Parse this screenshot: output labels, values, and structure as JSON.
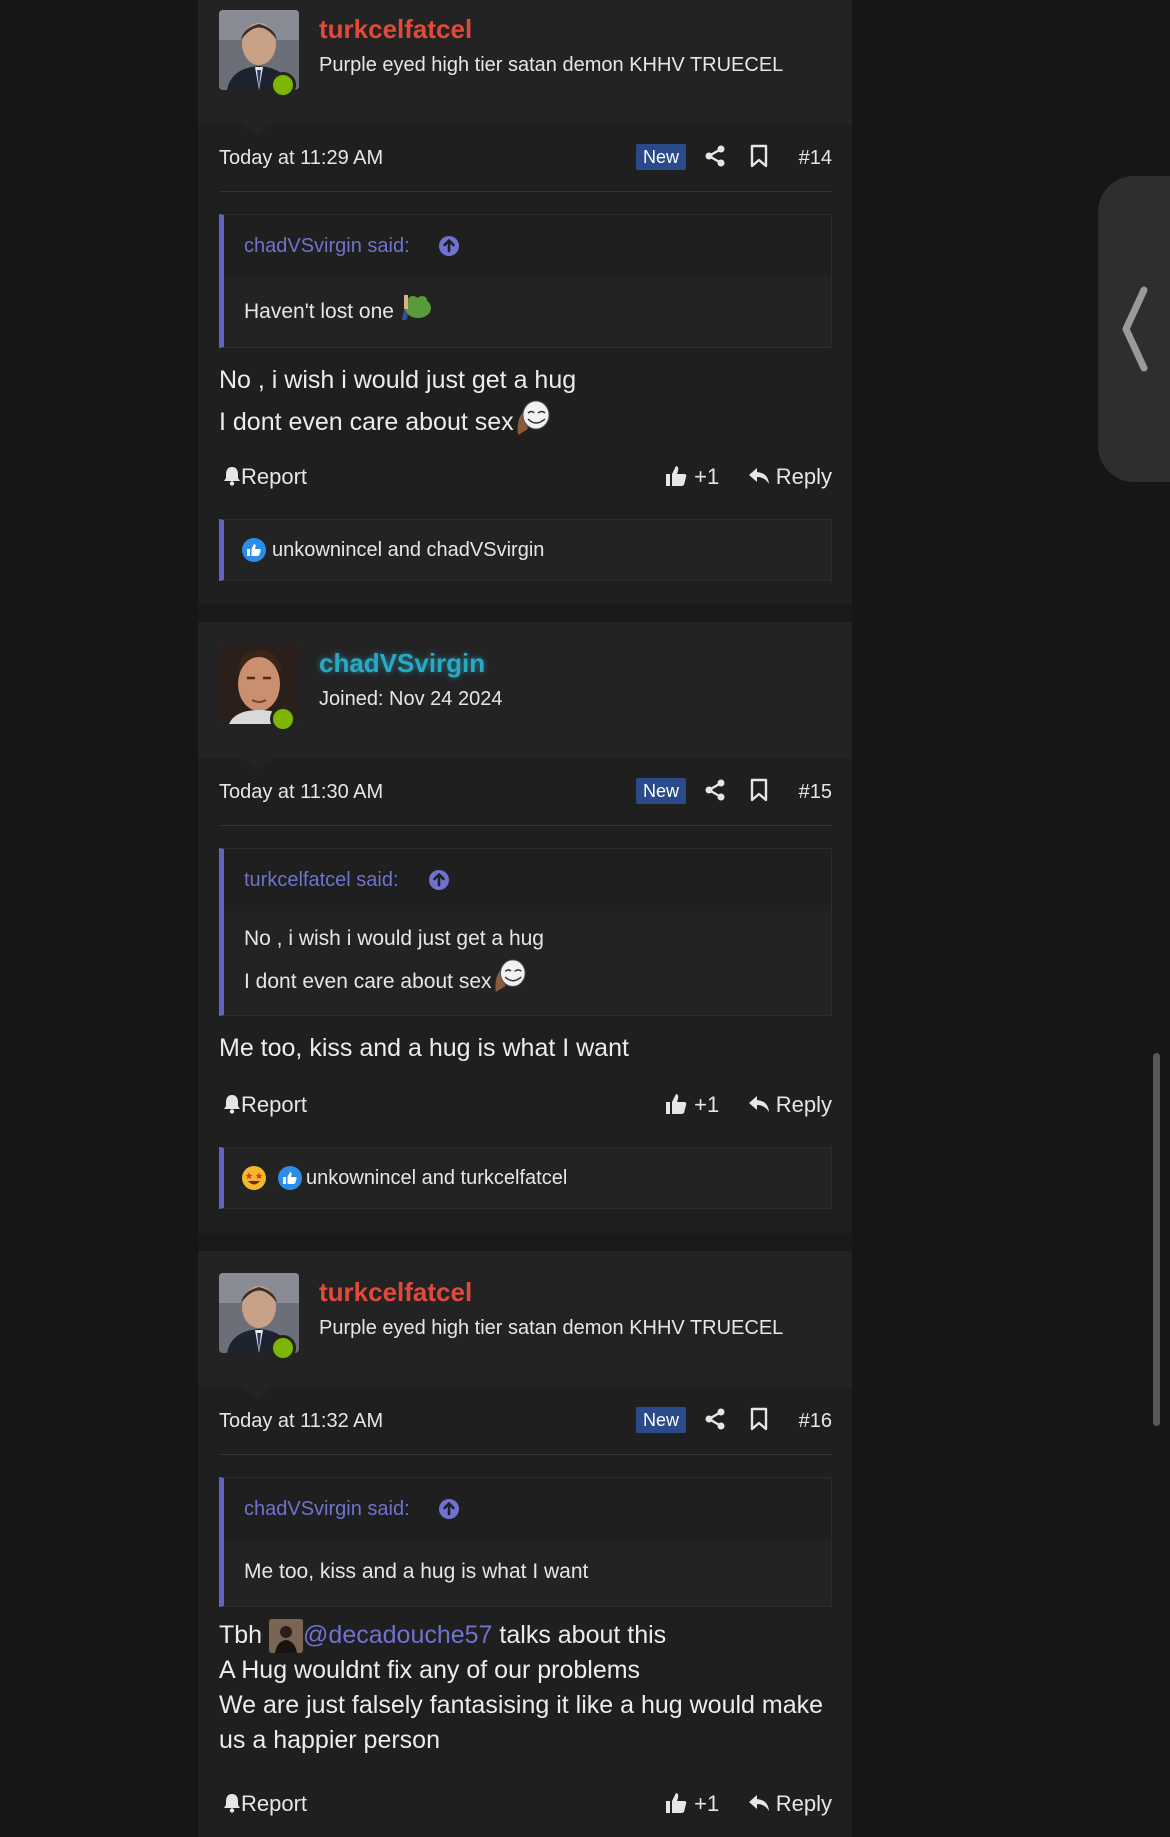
{
  "posts": [
    {
      "username": "turkcelfatcel",
      "user_title": "Purple eyed high tier satan demon KHHV TRUECEL",
      "time": "Today at 11:29 AM",
      "badge": "New",
      "number": "#14",
      "quote_author": "chadVSvirgin said:",
      "quote_text": "Haven't lost one",
      "body_lines": [
        "No , i wish i would just get a hug",
        "I dont even care about sex"
      ],
      "report": "Report",
      "like": "+1",
      "reply": "Reply",
      "reactions": "unkownincel and chadVSvirgin"
    },
    {
      "username": "chadVSvirgin",
      "user_title": "Joined: Nov 24 2024",
      "time": "Today at 11:30 AM",
      "badge": "New",
      "number": "#15",
      "quote_author": "turkcelfatcel said:",
      "quote_lines": [
        "No , i wish i would just get a hug",
        "I dont even care about sex"
      ],
      "body_lines": [
        "Me too, kiss and a hug is what I want"
      ],
      "report": "Report",
      "like": "+1",
      "reply": "Reply",
      "reactions": "unkownincel and turkcelfatcel"
    },
    {
      "username": "turkcelfatcel",
      "user_title": "Purple eyed high tier satan demon KHHV TRUECEL",
      "time": "Today at 11:32 AM",
      "badge": "New",
      "number": "#16",
      "quote_author": "chadVSvirgin said:",
      "quote_text": "Me too, kiss and a hug is what I want",
      "body_prefix": "Tbh",
      "mention": "@decadouche57",
      "body_suffix": "talks about this",
      "body_lines": [
        "A Hug wouldnt fix any of our problems",
        "We are just falsely fantasising it like a hug would make",
        "us a happier person"
      ],
      "report": "Report",
      "like": "+1",
      "reply": "Reply"
    }
  ],
  "colors": {
    "username_red": "#e04a3a",
    "username_teal": "#2aa9c3",
    "quote_accent": "#6164c2",
    "badge_bg": "#2b4a8a",
    "online": "#7cb600"
  }
}
